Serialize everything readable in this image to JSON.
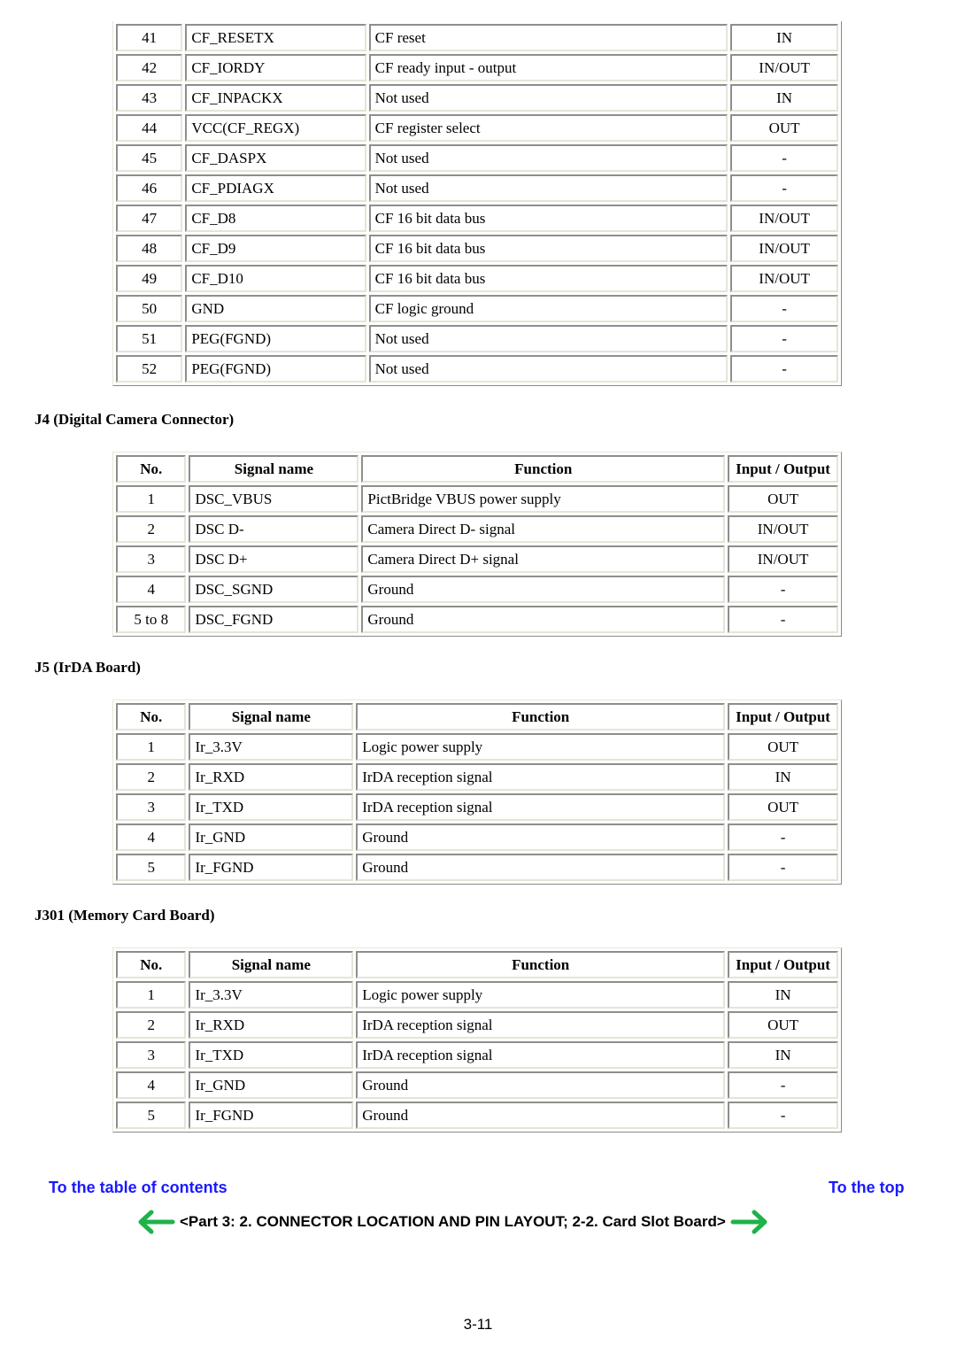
{
  "tables": {
    "j3_tail": {
      "rows": [
        {
          "no": "41",
          "signal": "CF_RESETX",
          "function": "CF reset",
          "io": "IN"
        },
        {
          "no": "42",
          "signal": "CF_IORDY",
          "function": "CF ready input - output",
          "io": "IN/OUT"
        },
        {
          "no": "43",
          "signal": "CF_INPACKX",
          "function": "Not used",
          "io": "IN"
        },
        {
          "no": "44",
          "signal": "VCC(CF_REGX)",
          "function": "CF register select",
          "io": "OUT"
        },
        {
          "no": "45",
          "signal": "CF_DASPX",
          "function": "Not used",
          "io": "-"
        },
        {
          "no": "46",
          "signal": "CF_PDIAGX",
          "function": "Not used",
          "io": "-"
        },
        {
          "no": "47",
          "signal": "CF_D8",
          "function": "CF 16 bit data bus",
          "io": "IN/OUT"
        },
        {
          "no": "48",
          "signal": "CF_D9",
          "function": "CF 16 bit data bus",
          "io": "IN/OUT"
        },
        {
          "no": "49",
          "signal": "CF_D10",
          "function": "CF 16 bit data bus",
          "io": "IN/OUT"
        },
        {
          "no": "50",
          "signal": "GND",
          "function": "CF logic ground",
          "io": "-"
        },
        {
          "no": "51",
          "signal": "PEG(FGND)",
          "function": "Not used",
          "io": "-"
        },
        {
          "no": "52",
          "signal": "PEG(FGND)",
          "function": "Not used",
          "io": "-"
        }
      ]
    },
    "j4": {
      "heading": "J4 (Digital Camera Connector)",
      "headers": {
        "no": "No.",
        "signal": "Signal name",
        "function": "Function",
        "io": "Input / Output"
      },
      "rows": [
        {
          "no": "1",
          "signal": "DSC_VBUS",
          "function": "PictBridge VBUS power supply",
          "io": "OUT"
        },
        {
          "no": "2",
          "signal": "DSC D-",
          "function": "Camera Direct D- signal",
          "io": "IN/OUT"
        },
        {
          "no": "3",
          "signal": "DSC D+",
          "function": "Camera Direct D+ signal",
          "io": "IN/OUT"
        },
        {
          "no": "4",
          "signal": "DSC_SGND",
          "function": "Ground",
          "io": "-"
        },
        {
          "no": "5 to 8",
          "signal": "DSC_FGND",
          "function": "Ground",
          "io": "-"
        }
      ]
    },
    "j5": {
      "heading": "J5 (IrDA Board)",
      "headers": {
        "no": "No.",
        "signal": "Signal name",
        "function": "Function",
        "io": "Input / Output"
      },
      "rows": [
        {
          "no": "1",
          "signal": "Ir_3.3V",
          "function": "Logic power supply",
          "io": "OUT"
        },
        {
          "no": "2",
          "signal": "Ir_RXD",
          "function": "IrDA reception signal",
          "io": "IN"
        },
        {
          "no": "3",
          "signal": "Ir_TXD",
          "function": "IrDA reception signal",
          "io": "OUT"
        },
        {
          "no": "4",
          "signal": "Ir_GND",
          "function": "Ground",
          "io": "-"
        },
        {
          "no": "5",
          "signal": "Ir_FGND",
          "function": "Ground",
          "io": "-"
        }
      ]
    },
    "j301": {
      "heading": "J301 (Memory Card Board)",
      "headers": {
        "no": "No.",
        "signal": "Signal name",
        "function": "Function",
        "io": "Input / Output"
      },
      "rows": [
        {
          "no": "1",
          "signal": "Ir_3.3V",
          "function": "Logic power supply",
          "io": "IN"
        },
        {
          "no": "2",
          "signal": "Ir_RXD",
          "function": "IrDA reception signal",
          "io": "OUT"
        },
        {
          "no": "3",
          "signal": "Ir_TXD",
          "function": "IrDA reception signal",
          "io": "IN"
        },
        {
          "no": "4",
          "signal": "Ir_GND",
          "function": "Ground",
          "io": "-"
        },
        {
          "no": "5",
          "signal": "Ir_FGND",
          "function": "Ground",
          "io": "-"
        }
      ]
    }
  },
  "footer": {
    "toc_link": "To the table of contents",
    "top_link": "To the top",
    "nav_text": "<Part 3:  2. CONNECTOR LOCATION AND PIN LAYOUT;  2-2. Card Slot Board>",
    "prev_icon": "arrow-left-icon",
    "next_icon": "arrow-right-icon",
    "page_number": "3-11",
    "link_color": "#1a1aff",
    "arrow_color": "#1db34a"
  }
}
